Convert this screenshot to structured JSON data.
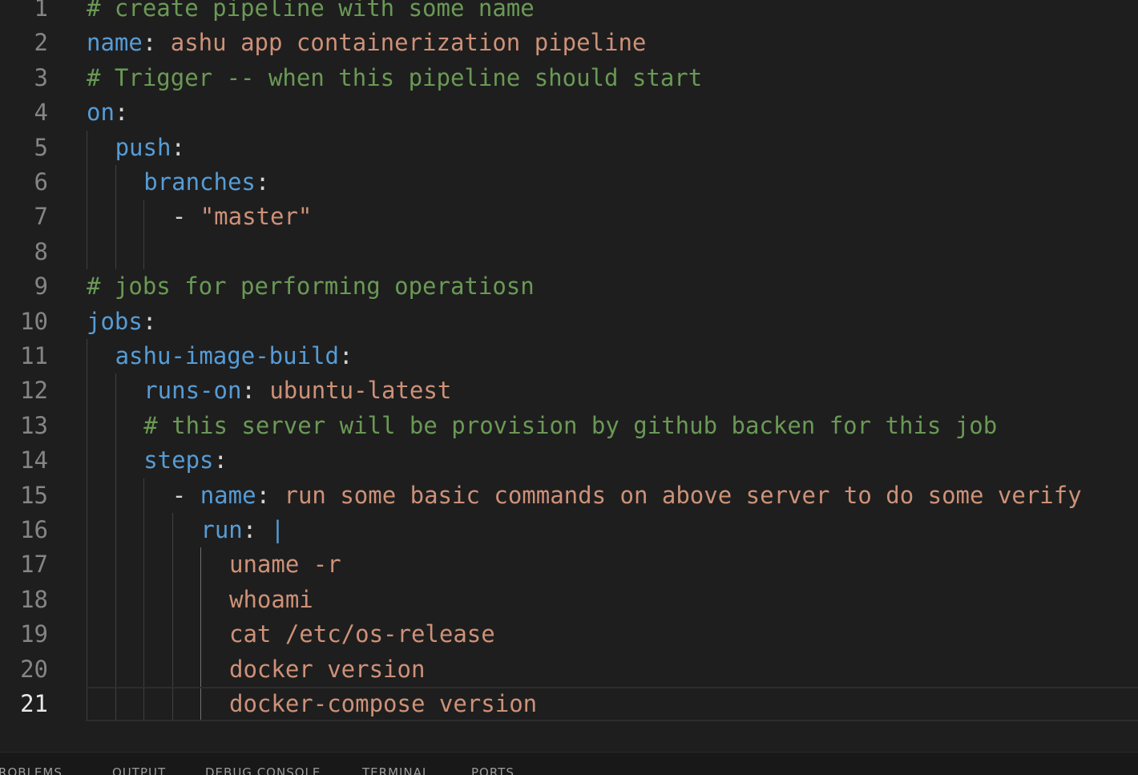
{
  "editor": {
    "current_line": 21,
    "lines": [
      {
        "num": "1",
        "parts": [
          {
            "t": "# create pipeline with some name",
            "c": "c"
          }
        ]
      },
      {
        "num": "2",
        "parts": [
          {
            "t": "name",
            "c": "k"
          },
          {
            "t": ": ",
            "c": "p"
          },
          {
            "t": "ashu app containerization pipeline",
            "c": "s"
          }
        ]
      },
      {
        "num": "3",
        "parts": [
          {
            "t": "# Trigger -- when this pipeline should start",
            "c": "c"
          }
        ]
      },
      {
        "num": "4",
        "parts": [
          {
            "t": "on",
            "c": "k"
          },
          {
            "t": ":",
            "c": "p"
          }
        ]
      },
      {
        "num": "5",
        "parts": [
          {
            "t": "push",
            "c": "k"
          },
          {
            "t": ":",
            "c": "p"
          }
        ]
      },
      {
        "num": "6",
        "parts": [
          {
            "t": "branches",
            "c": "k"
          },
          {
            "t": ":",
            "c": "p"
          }
        ]
      },
      {
        "num": "7",
        "parts": [
          {
            "t": "- ",
            "c": "p"
          },
          {
            "t": "\"master\"",
            "c": "s"
          }
        ]
      },
      {
        "num": "8",
        "parts": []
      },
      {
        "num": "9",
        "parts": [
          {
            "t": "# jobs for performing operatiosn",
            "c": "c"
          }
        ]
      },
      {
        "num": "10",
        "parts": [
          {
            "t": "jobs",
            "c": "k"
          },
          {
            "t": ":",
            "c": "p"
          }
        ]
      },
      {
        "num": "11",
        "parts": [
          {
            "t": "ashu-image-build",
            "c": "k"
          },
          {
            "t": ":",
            "c": "p"
          }
        ]
      },
      {
        "num": "12",
        "parts": [
          {
            "t": "runs-on",
            "c": "k"
          },
          {
            "t": ": ",
            "c": "p"
          },
          {
            "t": "ubuntu-latest",
            "c": "s"
          }
        ]
      },
      {
        "num": "13",
        "parts": [
          {
            "t": "# this server will be provision by github backen for this job",
            "c": "c"
          }
        ]
      },
      {
        "num": "14",
        "parts": [
          {
            "t": "steps",
            "c": "k"
          },
          {
            "t": ":",
            "c": "p"
          }
        ]
      },
      {
        "num": "15",
        "parts": [
          {
            "t": "- ",
            "c": "p"
          },
          {
            "t": "name",
            "c": "k"
          },
          {
            "t": ": ",
            "c": "p"
          },
          {
            "t": "run some basic commands on above server to do some verify",
            "c": "s"
          }
        ]
      },
      {
        "num": "16",
        "parts": [
          {
            "t": "run",
            "c": "k"
          },
          {
            "t": ": ",
            "c": "p"
          },
          {
            "t": "|",
            "c": "k"
          }
        ]
      },
      {
        "num": "17",
        "parts": [
          {
            "t": "uname -r",
            "c": "s"
          }
        ]
      },
      {
        "num": "18",
        "parts": [
          {
            "t": "whoami",
            "c": "s"
          }
        ]
      },
      {
        "num": "19",
        "parts": [
          {
            "t": "cat /etc/os-release",
            "c": "s"
          }
        ]
      },
      {
        "num": "20",
        "parts": [
          {
            "t": "docker version",
            "c": "s"
          }
        ]
      },
      {
        "num": "21",
        "parts": [
          {
            "t": "docker-compose version",
            "c": "s"
          }
        ]
      }
    ]
  },
  "panel": {
    "tabs": [
      "PROBLEMS",
      "OUTPUT",
      "DEBUG CONSOLE",
      "TERMINAL",
      "PORTS"
    ]
  }
}
